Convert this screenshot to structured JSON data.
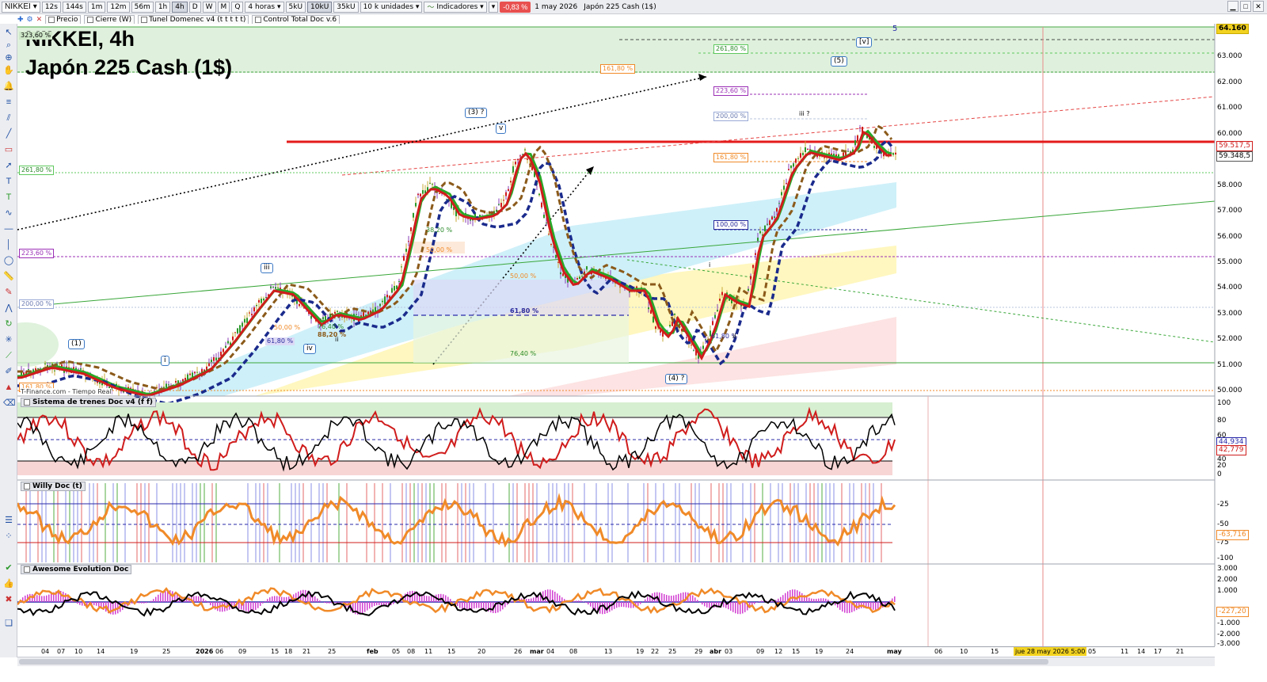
{
  "toolbar": {
    "symbol": "NIKKEI",
    "timeframes": [
      "12s",
      "144s",
      "1m",
      "12m",
      "56m",
      "1h",
      "4h",
      "D",
      "W",
      "M",
      "Q"
    ],
    "active_timeframe": "4h",
    "period": "4 horas",
    "units": [
      "5kU",
      "10kU",
      "35kU"
    ],
    "active_unit": "10kU",
    "units_dropdown": "10 k unidades",
    "indicators_label": "Indicadores",
    "change": "-0,83 %",
    "date": "1 may 2026",
    "instrument_name": "Japón 225 Cash (1$)"
  },
  "indicator_bar": {
    "items": [
      "Precio",
      "Cierre (W)",
      "Tunel Domenec v4 (t t t t t)",
      "Control Total Doc v.6"
    ]
  },
  "chart": {
    "title_line1": "NIKKEI, 4h",
    "title_line2": "Japón 225 Cash (1$)",
    "wave5_top": "5",
    "price_axis": [
      "63.000",
      "62.000",
      "61.000",
      "60.000",
      "59.000",
      "58.000",
      "57.000",
      "56.000",
      "55.000",
      "54.000",
      "53.000",
      "52.000",
      "51.000",
      "50.000"
    ],
    "price_tags": {
      "top": "64.160",
      "last1": "59.517,5",
      "last2": "59.348,5"
    },
    "fib_left": [
      "323,60 %",
      "261,80 %",
      "223,60 %",
      "200,00 %",
      "161,80 %"
    ],
    "fib_levels": [
      "261,80 %",
      "161,80 %",
      "223,60 %",
      "200,00 %",
      "161,80 %",
      "100,00 %",
      "38,20 %",
      "50,00 %",
      "50,00 %",
      "61,80 %",
      "76,40 %",
      "50,00 %",
      "61,80 %",
      "76,40 %",
      "88,20 %",
      "61,80 %"
    ],
    "wave_labels": [
      "(1)",
      "(3) ?",
      "v",
      "(4) ?",
      "(5)",
      "[v]",
      "iii",
      "iv",
      "i",
      "ii",
      "iii ?",
      "i",
      "ii"
    ],
    "source": "T-Finance.com - Tiempo Real"
  },
  "panels": {
    "trenes": {
      "title": "Sistema de trenes Doc v4 (f f)",
      "axis": [
        "100",
        "80",
        "60",
        "40",
        "20",
        "0"
      ],
      "tags": [
        "44,934",
        "42,779"
      ]
    },
    "willy": {
      "title": "Willy Doc (t)",
      "axis": [
        "-25",
        "-50",
        "-75",
        "-100"
      ],
      "tags": [
        "-63,716"
      ]
    },
    "awesome": {
      "title": "Awesome Evolution Doc",
      "axis": [
        "3.000",
        "2.000",
        "1.000",
        "-1.000",
        "-2.000",
        "-3.000"
      ],
      "tags": [
        "-227,20"
      ]
    }
  },
  "date_axis": {
    "labels": [
      "04",
      "07",
      "10",
      "14",
      "19",
      "25",
      "2026",
      "06",
      "09",
      "15",
      "18",
      "21",
      "25",
      "feb",
      "05",
      "08",
      "11",
      "15",
      "20",
      "26",
      "mar",
      "04",
      "08",
      "13",
      "19",
      "22",
      "25",
      "29",
      "abr",
      "03",
      "09",
      "12",
      "15",
      "19",
      "24",
      "may",
      "06",
      "10",
      "15",
      "21",
      "05",
      "11",
      "14",
      "17",
      "21"
    ],
    "highlight": "jue 28 may 2026 5:00"
  },
  "colors": {
    "red_line": "#e41b1b",
    "green_line": "#39a639",
    "blue_dash": "#1a2a8c",
    "fib_green": "#5ec85e",
    "fib_purple": "#9b2fb6",
    "fib_orange": "#f08a28"
  }
}
